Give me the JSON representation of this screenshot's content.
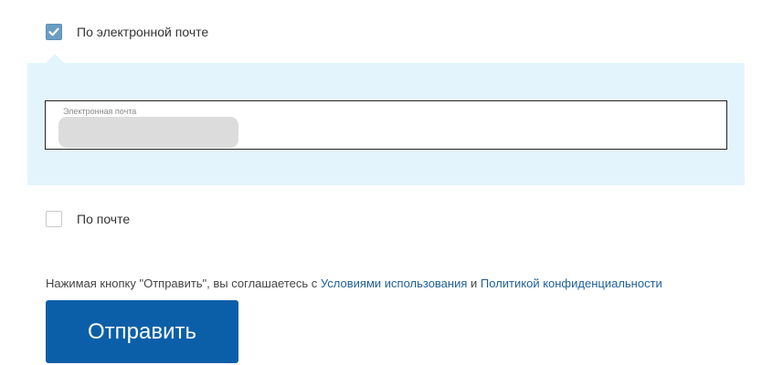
{
  "options": {
    "email": {
      "label": "По электронной почте",
      "checked": true,
      "icon": "check-icon"
    },
    "post": {
      "label": "По почте",
      "checked": false
    }
  },
  "email_field": {
    "label": "Электронная почта",
    "value": ""
  },
  "agreement": {
    "prefix": "Нажимая кнопку \"Отправить\", вы соглашаетесь с ",
    "terms_link": "Условиями использования",
    "conjunction": " и ",
    "privacy_link": "Политикой конфиденциальности"
  },
  "submit": {
    "label": "Отправить"
  },
  "colors": {
    "panel_background": "#e4f4fd",
    "checkbox_checked": "#6b9ec4",
    "link": "#1e5f96",
    "button": "#0b5fa8"
  }
}
